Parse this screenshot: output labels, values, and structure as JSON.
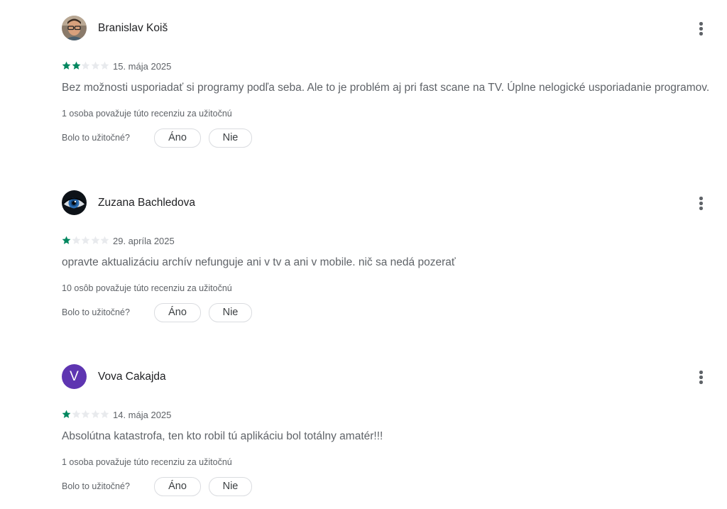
{
  "helpful_question": "Bolo to užitočné?",
  "yes_label": "Áno",
  "no_label": "Nie",
  "colors": {
    "star_filled": "#01875f",
    "star_empty": "#e8eaed",
    "avatar_purple": "#5e35b1"
  },
  "reviews": [
    {
      "author": "Branislav Koiš",
      "avatar": "photo-icon",
      "rating": 2,
      "max_rating": 5,
      "date": "15. mája 2025",
      "text": "Bez možnosti usporiadať si programy podľa seba. Ale to je problém aj pri fast scane na TV. Úplne nelogické usporiadanie programov.",
      "helpful_count": "1 osoba považuje túto recenziu za užitočnú"
    },
    {
      "author": "Zuzana Bachledova",
      "avatar": "eye-photo-icon",
      "rating": 1,
      "max_rating": 5,
      "date": "29. apríla 2025",
      "text": "opravte aktualizáciu archív nefunguje ani v tv a ani v mobile. nič sa nedá pozerať",
      "helpful_count": "10 osôb považuje túto recenziu za užitočnú"
    },
    {
      "author": "Vova Cakajda",
      "avatar_letter": "V",
      "rating": 1,
      "max_rating": 5,
      "date": "14. mája 2025",
      "text": "Absolútna katastrofa, ten kto robil tú aplikáciu bol totálny amatér!!!",
      "helpful_count": "1 osoba považuje túto recenziu za užitočnú"
    }
  ]
}
